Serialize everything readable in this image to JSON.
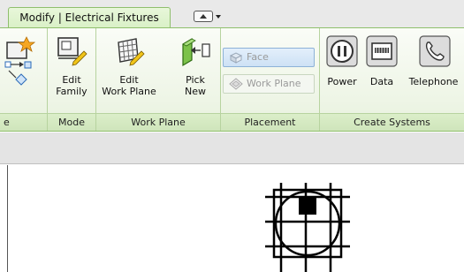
{
  "tabs": {
    "active_label": "Modify | Electrical Fixtures",
    "quick_access_icon": "ribbon-minimize-icon"
  },
  "ribbon": {
    "panels": [
      {
        "label": "e"
      },
      {
        "label": "Mode"
      },
      {
        "label": "Work Plane"
      },
      {
        "label": "Placement"
      },
      {
        "label": "Create Systems"
      }
    ],
    "mode": {
      "edit_family": {
        "line1": "Edit",
        "line2": "Family",
        "icon": "edit-family-icon"
      }
    },
    "work_plane": {
      "edit_work_plane": {
        "line1": "Edit",
        "line2": "Work Plane",
        "icon": "edit-work-plane-icon"
      },
      "pick_new": {
        "line1": "Pick",
        "line2": "New",
        "icon": "pick-new-icon"
      }
    },
    "placement": {
      "face": {
        "label": "Face",
        "icon": "face-icon",
        "state": "selected"
      },
      "work_plane": {
        "label": "Work Plane",
        "icon": "work-plane-icon"
      }
    },
    "create_systems": {
      "power": {
        "label": "Power",
        "icon": "power-icon"
      },
      "data": {
        "label": "Data",
        "icon": "data-icon"
      },
      "telephone": {
        "label": "Telephone",
        "icon": "telephone-icon"
      }
    }
  },
  "colors": {
    "accent_green": "#8fbf6d",
    "selection_blue": "#cde1f5"
  }
}
